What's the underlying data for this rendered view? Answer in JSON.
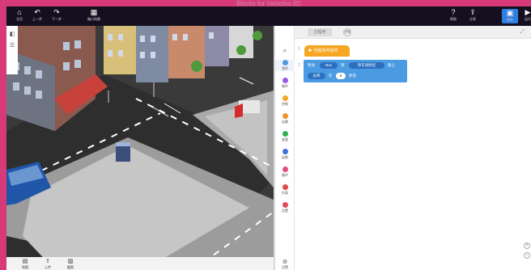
{
  "window": {
    "title": "Blocks for Vehicles 2D"
  },
  "toolbar": {
    "home": "主页",
    "undo": "上一步",
    "redo": "下一步",
    "scene": "路口场景",
    "help": "帮助",
    "share": "分享",
    "code_mode": "积木",
    "run": "运行"
  },
  "scene_bar": {
    "b1": "地图",
    "b2": "上传",
    "b3": "截图"
  },
  "categories": [
    {
      "label": "搜索",
      "color": "#888888"
    },
    {
      "label": "我的",
      "color": "#4b9be3"
    },
    {
      "label": "事件",
      "color": "#9b59e8"
    },
    {
      "label": "控制",
      "color": "#f5a623"
    },
    {
      "label": "运算",
      "color": "#f0932b"
    },
    {
      "label": "变量",
      "color": "#2fb056"
    },
    {
      "label": "函数",
      "color": "#3d6fe0"
    },
    {
      "label": "循环",
      "color": "#e54b7a"
    },
    {
      "label": "列表",
      "color": "#e04848"
    },
    {
      "label": "设置",
      "color": "#e64560"
    }
  ],
  "tabs": {
    "t1": "主程序",
    "t2": "分支",
    "add": "+"
  },
  "code": {
    "line1": "1",
    "line2": "2",
    "hat_label": "当程序开始时",
    "b_move": "移动",
    "b_obj": "Bus",
    "b_to": "到",
    "b_target": "停车场附近",
    "b_tail": "路上",
    "b_dir": "右转",
    "b_mid": "在",
    "b_num": "5",
    "b_unit": "秒后"
  },
  "settings_label": "设置",
  "colors": {
    "accent": "#2f7fe0",
    "frame": "#d63a78",
    "hat": "#f5a623",
    "motion": "#4b9be3"
  }
}
